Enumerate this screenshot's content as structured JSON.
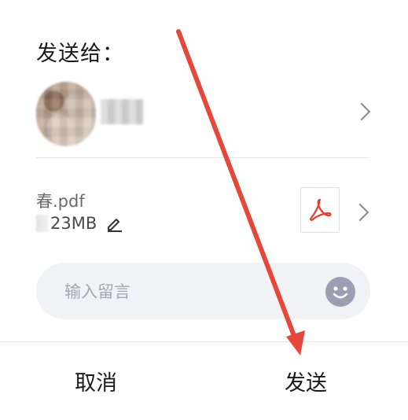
{
  "dialog": {
    "title": "发送给：",
    "file": {
      "name": "春.pdf",
      "size": "23MB",
      "type_icon": "pdf-icon"
    },
    "message": {
      "placeholder": "输入留言"
    },
    "footer": {
      "cancel_label": "取消",
      "send_label": "发送"
    }
  },
  "icons": {
    "chevron": "chevron-right-icon",
    "edit": "pencil-icon",
    "emoji": "smiley-icon"
  },
  "colors": {
    "annotation_arrow": "#e5473a",
    "pdf_red": "#e53935",
    "emoji_fill": "#9aa0b1",
    "input_bg": "#f1f2f6"
  }
}
